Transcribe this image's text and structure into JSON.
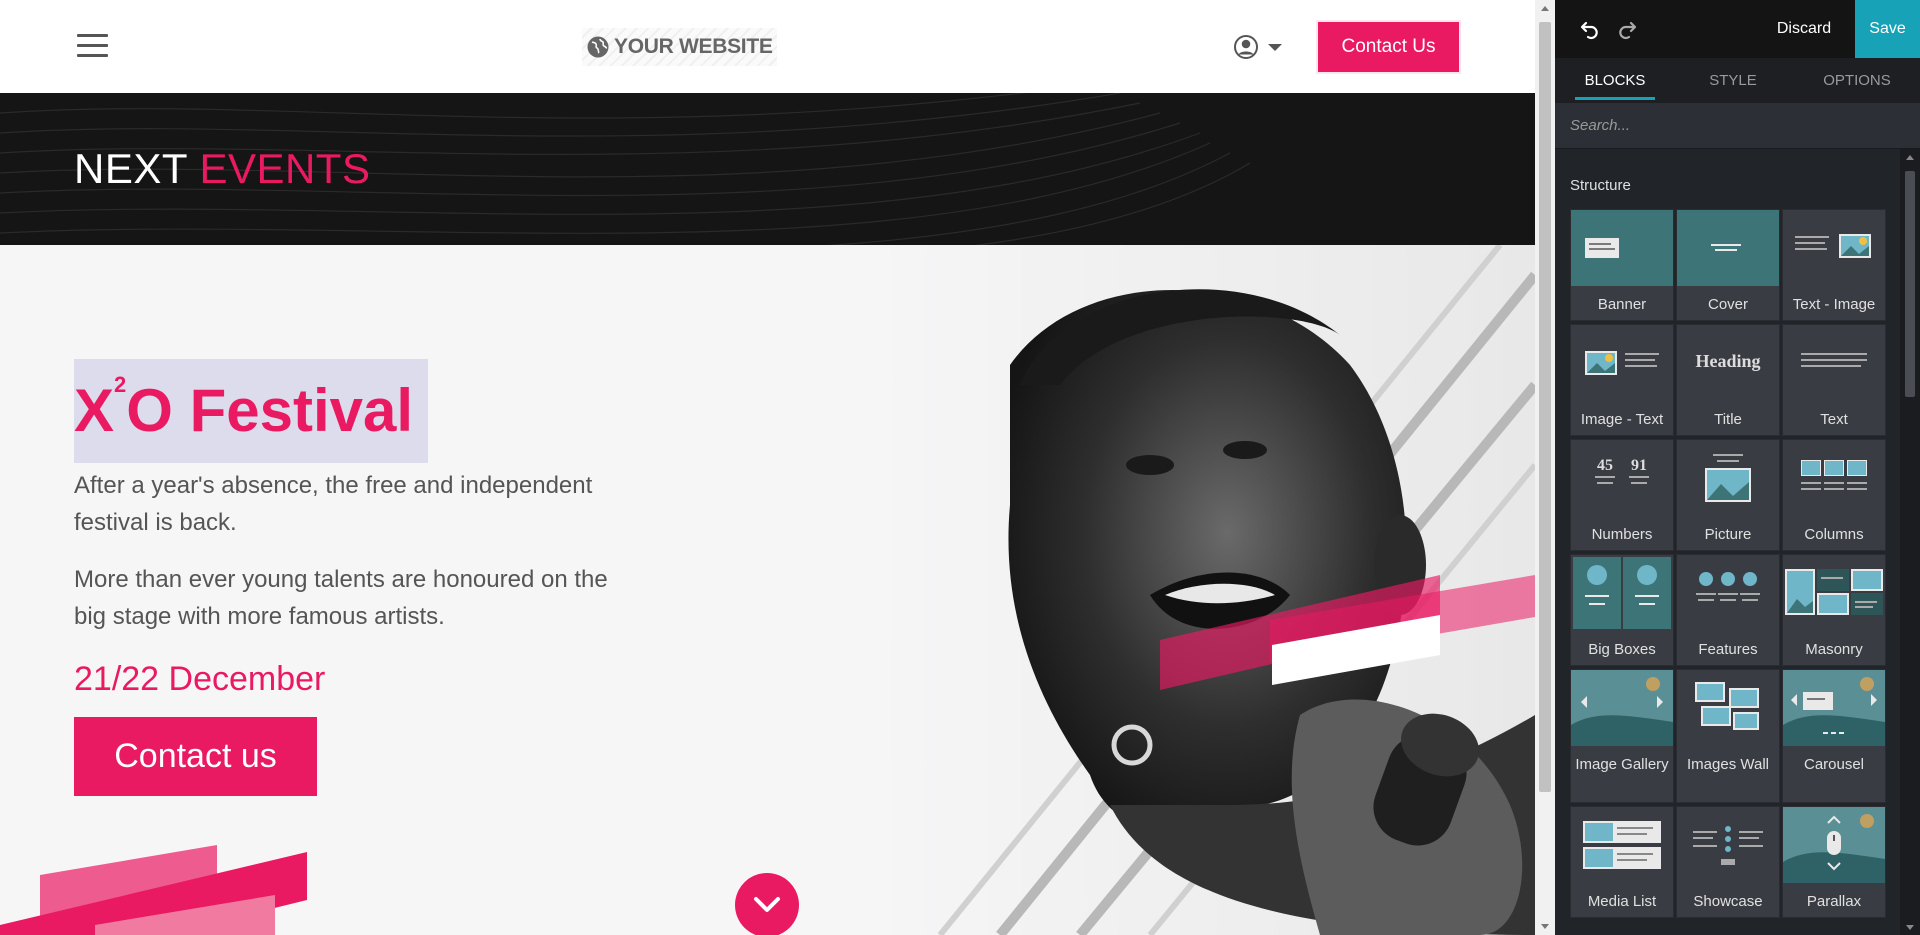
{
  "navbar": {
    "logo_text": "YOUR WEBSITE",
    "contact_label": "Contact Us"
  },
  "events": {
    "title_white": "NEXT",
    "title_accent": "EVENTS"
  },
  "hero": {
    "title_prefix": "X",
    "title_sup": "2",
    "title_suffix": "O Festival",
    "paragraph1": "After a year's absence, the free and independent festival is back.",
    "paragraph2": "More than ever young talents are honoured on the big stage with more famous artists.",
    "date": "21/22 December",
    "button_label": "Contact us"
  },
  "editor": {
    "discard_label": "Discard",
    "save_label": "Save",
    "tabs": [
      {
        "label": "BLOCKS",
        "active": true
      },
      {
        "label": "STYLE",
        "active": false
      },
      {
        "label": "OPTIONS",
        "active": false
      }
    ],
    "search_placeholder": "Search...",
    "section_title": "Structure",
    "blocks": [
      {
        "label": "Banner",
        "icon": "banner-icon"
      },
      {
        "label": "Cover",
        "icon": "cover-icon"
      },
      {
        "label": "Text - Image",
        "icon": "text-image-icon"
      },
      {
        "label": "Image - Text",
        "icon": "image-text-icon"
      },
      {
        "label": "Title",
        "icon": "title-icon",
        "thumb_text": "Heading"
      },
      {
        "label": "Text",
        "icon": "text-icon"
      },
      {
        "label": "Numbers",
        "icon": "numbers-icon",
        "thumb_num1": "45",
        "thumb_num2": "91"
      },
      {
        "label": "Picture",
        "icon": "picture-icon"
      },
      {
        "label": "Columns",
        "icon": "columns-icon"
      },
      {
        "label": "Big Boxes",
        "icon": "big-boxes-icon"
      },
      {
        "label": "Features",
        "icon": "features-icon"
      },
      {
        "label": "Masonry",
        "icon": "masonry-icon"
      },
      {
        "label": "Image Gallery",
        "icon": "image-gallery-icon"
      },
      {
        "label": "Images Wall",
        "icon": "images-wall-icon"
      },
      {
        "label": "Carousel",
        "icon": "carousel-icon"
      },
      {
        "label": "Media List",
        "icon": "media-list-icon"
      },
      {
        "label": "Showcase",
        "icon": "showcase-icon"
      },
      {
        "label": "Parallax",
        "icon": "parallax-icon"
      }
    ]
  },
  "colors": {
    "brand": "#ea1a62",
    "editor_accent": "#17a2b8",
    "editor_bg": "#212429",
    "band_bg": "#151515"
  }
}
